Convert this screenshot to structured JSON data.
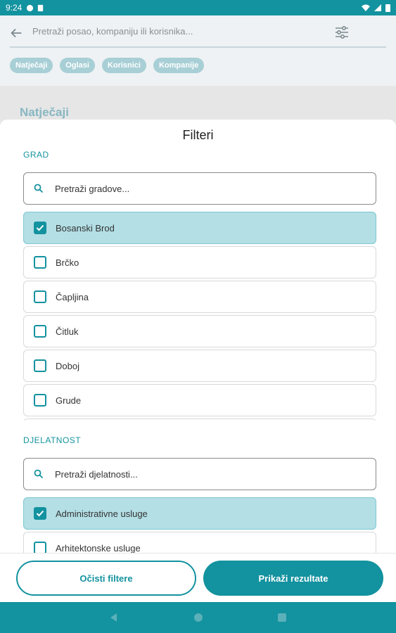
{
  "status_bar": {
    "time": "9:24"
  },
  "header": {
    "search_placeholder": "Pretraži posao, kompaniju ili korisnika...",
    "chips": [
      "Natječaji",
      "Oglasi",
      "Korisnici",
      "Kompanije"
    ],
    "section_title": "Natječaji"
  },
  "filters": {
    "title": "Filteri",
    "grad": {
      "label": "GRAD",
      "search_placeholder": "Pretraži gradove...",
      "items": [
        {
          "label": "Bosanski Brod",
          "checked": true
        },
        {
          "label": "Brčko",
          "checked": false
        },
        {
          "label": "Čapljina",
          "checked": false
        },
        {
          "label": "Čitluk",
          "checked": false
        },
        {
          "label": "Doboj",
          "checked": false
        },
        {
          "label": "Grude",
          "checked": false
        }
      ]
    },
    "djelatnost": {
      "label": "DJELATNOST",
      "search_placeholder": "Pretraži djelatnosti...",
      "items": [
        {
          "label": "Administrativne usluge",
          "checked": true
        },
        {
          "label": "Arhitektonske usluge",
          "checked": false
        }
      ]
    }
  },
  "actions": {
    "clear_label": "Očisti filtere",
    "show_label": "Prikaži rezultate"
  },
  "colors": {
    "accent": "#13929f",
    "selected_bg": "#b3dfe5",
    "chip_bg": "#a8cfd6"
  }
}
